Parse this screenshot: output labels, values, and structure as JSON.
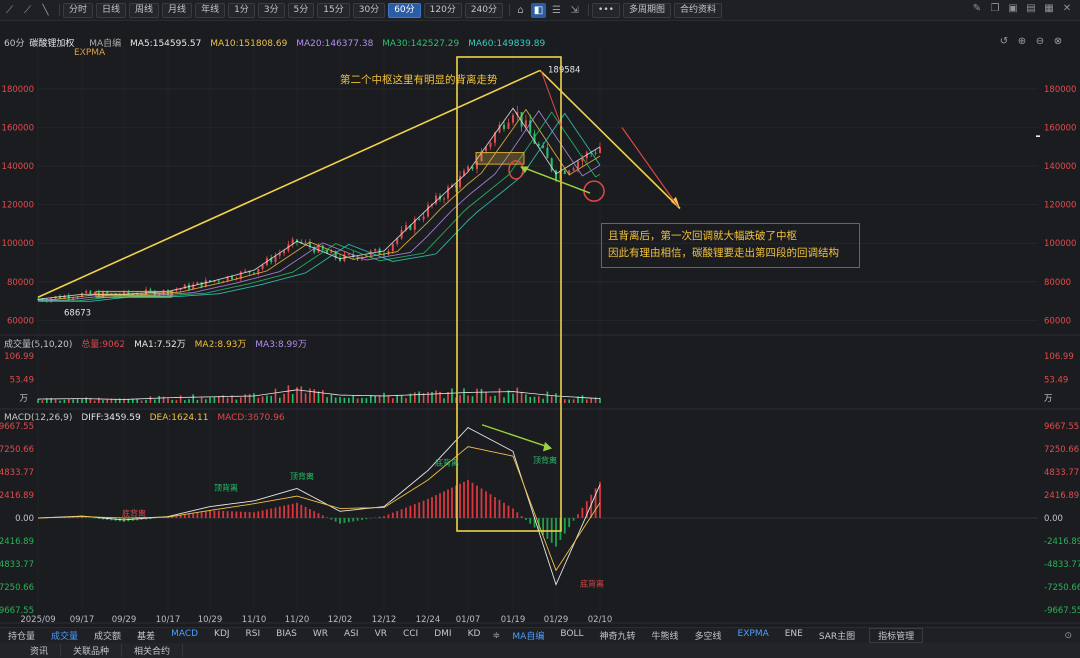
{
  "toolbar": {
    "period_buttons": [
      "分时",
      "日线",
      "周线",
      "月线",
      "年线",
      "1分",
      "3分",
      "5分",
      "15分",
      "30分",
      "60分",
      "120分",
      "240分"
    ],
    "active_period": "60分",
    "more_label": "•••",
    "multi_period_label": "多周期图",
    "contract_info_label": "合约资料"
  },
  "main_legend": {
    "period_name": "60分",
    "symbol": "碳酸锂加权",
    "ma_label": "MA自编",
    "ma5": "MA5:154595.57",
    "ma10": "MA10:151808.69",
    "ma20": "MA20:146377.38",
    "ma30": "MA30:142527.29",
    "ma60": "MA60:149839.89",
    "expma": "EXPMA",
    "colors": {
      "ma5": "#e8e8e8",
      "ma10": "#f0c040",
      "ma20": "#b58cf0",
      "ma30": "#27c26b",
      "ma60": "#2fd0c0"
    }
  },
  "volume_legend": {
    "title": "成交量(5,10,20)",
    "total": "总量:9062",
    "ma1": "MA1:7.52万",
    "ma2": "MA2:8.93万",
    "ma3": "MA3:8.99万"
  },
  "macd_legend": {
    "title": "MACD(12,26,9)",
    "diff": "DIFF:3459.59",
    "dea": "DEA:1624.11",
    "macd": "MACD:3670.96"
  },
  "annotations": {
    "top_text": "第二个中枢这里有明显的背离走势",
    "box_line1": "且背离后，第一次回调就大幅跌破了中枢",
    "box_line2": "因此有理由相信，碳酸锂要走出第四段的回调结构",
    "high_label": "189584",
    "low_label": "68673",
    "macd_marks": [
      "顶背离",
      "底背离",
      "顶背离",
      "底背离",
      "顶背离",
      "底背离"
    ]
  },
  "bottom_tabs": [
    "持仓量",
    "成交量",
    "成交额",
    "基差",
    "MACD",
    "KDJ",
    "RSI",
    "BIAS",
    "WR",
    "ASI",
    "VR",
    "CCI",
    "DMI",
    "KD"
  ],
  "bottom_tabs_right": [
    "MA自编",
    "BOLL",
    "神奇九转",
    "牛熊线",
    "多空线",
    "EXPMA",
    "ENE",
    "SAR主图"
  ],
  "active_tabs": [
    "成交量",
    "MACD",
    "MA自编",
    "EXPMA"
  ],
  "indicator_mgmt": "指标管理",
  "bottom_bar": [
    "资讯",
    "关联品种",
    "相关合约"
  ],
  "chart_data": {
    "type": "line",
    "title": "",
    "x_ticks": [
      "2025/09",
      "09/17",
      "09/29",
      "10/17",
      "10/29",
      "11/10",
      "11/20",
      "12/02",
      "12/12",
      "12/24",
      "01/07",
      "01/19",
      "01/29",
      "02/10"
    ],
    "price": {
      "ylim": [
        55000,
        195000
      ],
      "y_ticks": [
        60000,
        80000,
        100000,
        120000,
        140000,
        160000,
        180000
      ],
      "x": [
        "2025/09",
        "09/17",
        "09/29",
        "10/17",
        "10/29",
        "11/10",
        "11/20",
        "12/02",
        "12/12",
        "12/24",
        "01/07",
        "01/19",
        "01/29",
        "02/10"
      ],
      "close": [
        71000,
        73500,
        73500,
        75000,
        80000,
        86000,
        101000,
        92000,
        96000,
        118000,
        137000,
        170000,
        136000,
        150000
      ],
      "high": 189584,
      "low": 68673
    },
    "volume": {
      "unit": "万",
      "y_ticks": [
        53.49,
        106.99
      ],
      "x": [
        "2025/09",
        "09/17",
        "09/29",
        "10/17",
        "10/29",
        "11/10",
        "11/20",
        "12/02",
        "12/12",
        "12/24",
        "01/07",
        "01/19",
        "01/29",
        "02/10"
      ],
      "ma_values": [
        9,
        10,
        8,
        12,
        14,
        16,
        30,
        18,
        16,
        20,
        24,
        26,
        16,
        10
      ]
    },
    "macd": {
      "y_ticks": [
        9667.55,
        7250.66,
        4833.77,
        2416.89,
        0.0,
        -2416.89,
        -4833.77,
        -7250.66,
        -9667.55
      ],
      "x": [
        "2025/09",
        "09/17",
        "09/29",
        "10/17",
        "10/29",
        "11/10",
        "11/20",
        "12/02",
        "12/12",
        "12/24",
        "01/07",
        "01/19",
        "01/29",
        "02/10"
      ],
      "diff": [
        0,
        200,
        -200,
        150,
        1200,
        1800,
        3100,
        700,
        1200,
        5000,
        9500,
        7000,
        -7000,
        3500
      ],
      "dea": [
        0,
        150,
        0,
        100,
        800,
        1500,
        2300,
        1000,
        1100,
        4000,
        7500,
        6500,
        -5500,
        1600
      ]
    }
  }
}
